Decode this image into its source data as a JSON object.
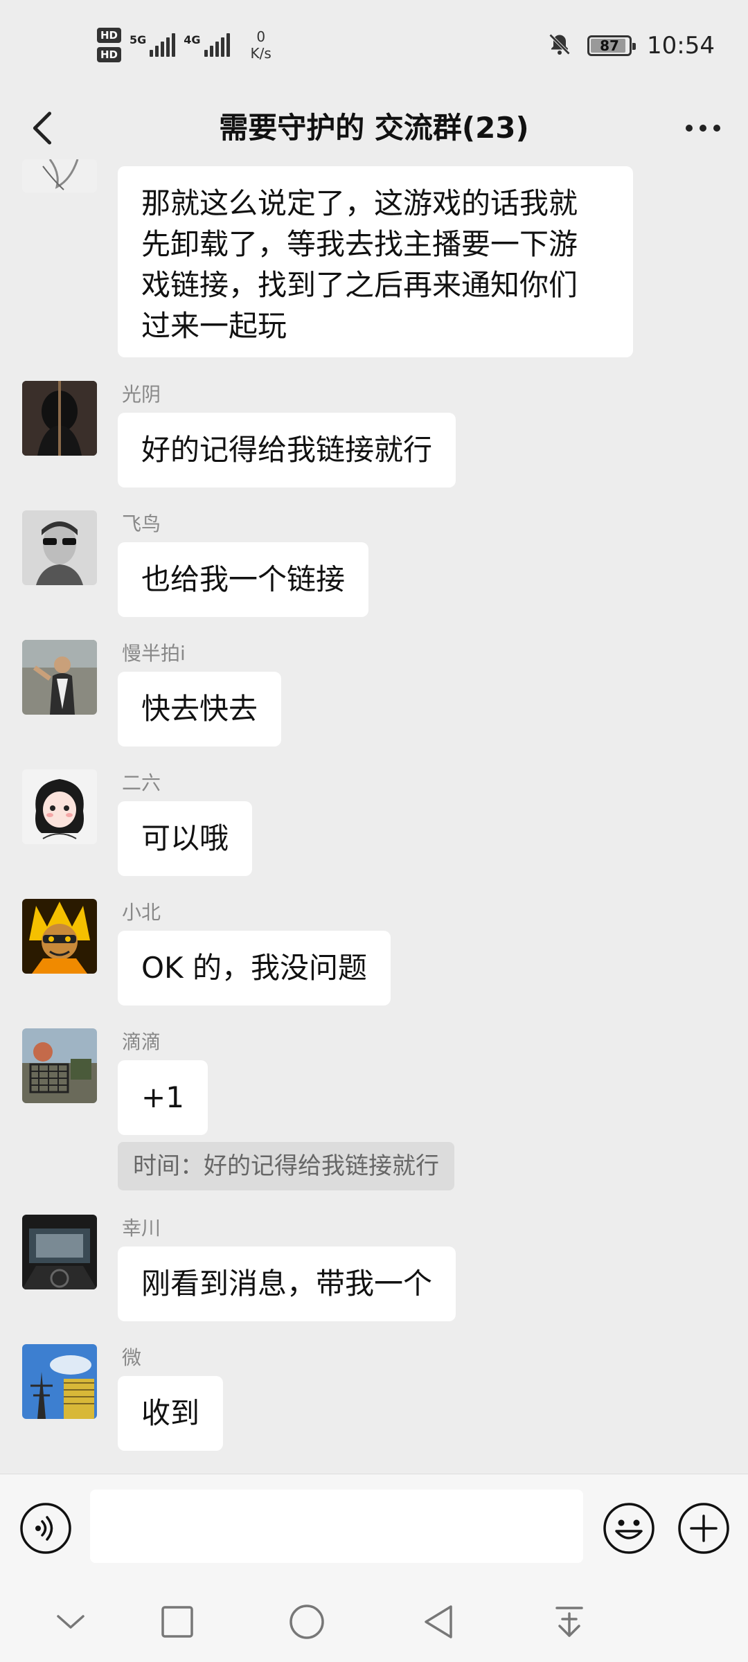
{
  "status_bar": {
    "network1": "5G",
    "network2": "4G",
    "speed_value": "0",
    "speed_unit": "K/s",
    "battery": "87",
    "time": "10:54"
  },
  "header": {
    "title": "需要守护的 交流群(23)"
  },
  "messages": [
    {
      "sender": "",
      "text_lines": [
        "那就这么说定了，这游戏的话我就",
        "先卸载了，等我去找主播要一下游",
        "戏链接，找到了之后再来通知你们",
        "过来一起玩"
      ]
    },
    {
      "sender": "光阴",
      "text": "好的记得给我链接就行"
    },
    {
      "sender": "飞鸟",
      "text": "也给我一个链接"
    },
    {
      "sender": "慢半拍i",
      "text": "快去快去"
    },
    {
      "sender": "二六",
      "text": "可以哦"
    },
    {
      "sender": "小北",
      "text": "OK 的，我没问题"
    },
    {
      "sender": "滴滴",
      "text": "+1",
      "quote": "时间：好的记得给我链接就行"
    },
    {
      "sender": "幸川",
      "text": "刚看到消息，带我一个"
    },
    {
      "sender": "微",
      "text": "收到"
    }
  ],
  "input": {
    "value": "",
    "placeholder": ""
  },
  "colors": {
    "background": "#ededed",
    "bubble": "#ffffff",
    "quote_bg": "#dcdcdc",
    "sender_name": "#888888"
  }
}
